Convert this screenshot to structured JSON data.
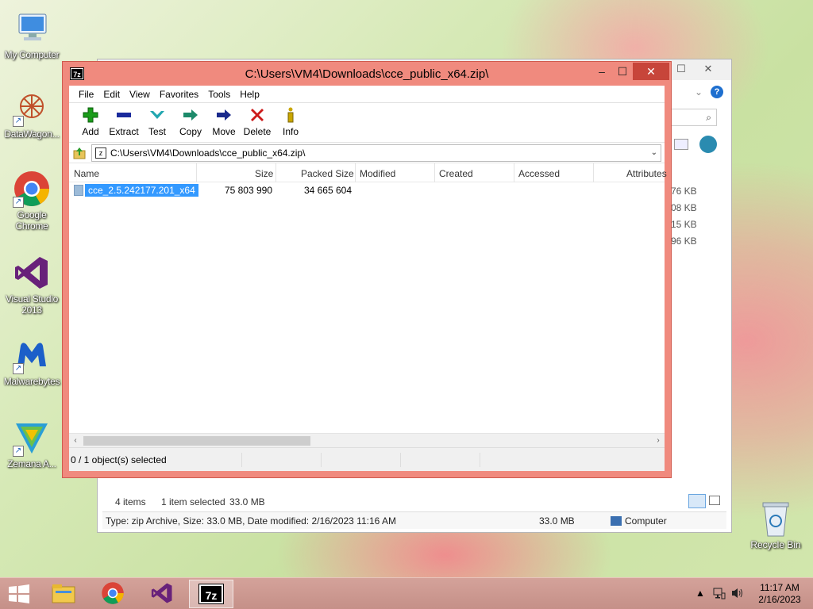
{
  "desktop": {
    "icons": [
      {
        "label": "My Computer"
      },
      {
        "label": "DataWagon..."
      },
      {
        "label": "Google Chrome"
      },
      {
        "label": "Visual Studio 2013"
      },
      {
        "label": "Malwarebytes"
      },
      {
        "label": "Zemana A..."
      }
    ],
    "recycle_bin": "Recycle Bin"
  },
  "explorer_bg": {
    "sizes": [
      "76 KB",
      "08 KB",
      "15 KB",
      "96 KB"
    ],
    "status_items": "4 items",
    "status_selected": "1 item selected",
    "status_size": "33.0 MB",
    "details_text": "Type: zip Archive, Size: 33.0 MB, Date modified: 2/16/2023 11:16 AM",
    "details_size": "33.0 MB",
    "details_location": "Computer"
  },
  "sevenzip": {
    "title": "C:\\Users\\VM4\\Downloads\\cce_public_x64.zip\\",
    "logo": "7z",
    "menu": [
      "File",
      "Edit",
      "View",
      "Favorites",
      "Tools",
      "Help"
    ],
    "toolbar": [
      {
        "label": "Add",
        "icon": "plus-icon",
        "color": "#1a9c1a"
      },
      {
        "label": "Extract",
        "icon": "minus-icon",
        "color": "#1a2a9c"
      },
      {
        "label": "Test",
        "icon": "check-icon",
        "color": "#23a7b0"
      },
      {
        "label": "Copy",
        "icon": "copy-arrow-icon",
        "color": "#1d8a6a"
      },
      {
        "label": "Move",
        "icon": "move-arrow-icon",
        "color": "#1a2a8c"
      },
      {
        "label": "Delete",
        "icon": "x-icon",
        "color": "#cc1a1a"
      },
      {
        "label": "Info",
        "icon": "info-icon",
        "color": "#c9a600"
      }
    ],
    "address": "C:\\Users\\VM4\\Downloads\\cce_public_x64.zip\\",
    "columns": [
      "Name",
      "Size",
      "Packed Size",
      "Modified",
      "Created",
      "Accessed",
      "Attributes"
    ],
    "files": [
      {
        "name": "cce_2.5.242177.201_x64",
        "size": "75 803 990",
        "packed": "34 665 604"
      }
    ],
    "status": "0 / 1 object(s) selected"
  },
  "taskbar": {
    "apps": [
      "file-explorer",
      "google-chrome",
      "visual-studio",
      "7-zip"
    ],
    "time": "11:17 AM",
    "date": "2/16/2023"
  }
}
